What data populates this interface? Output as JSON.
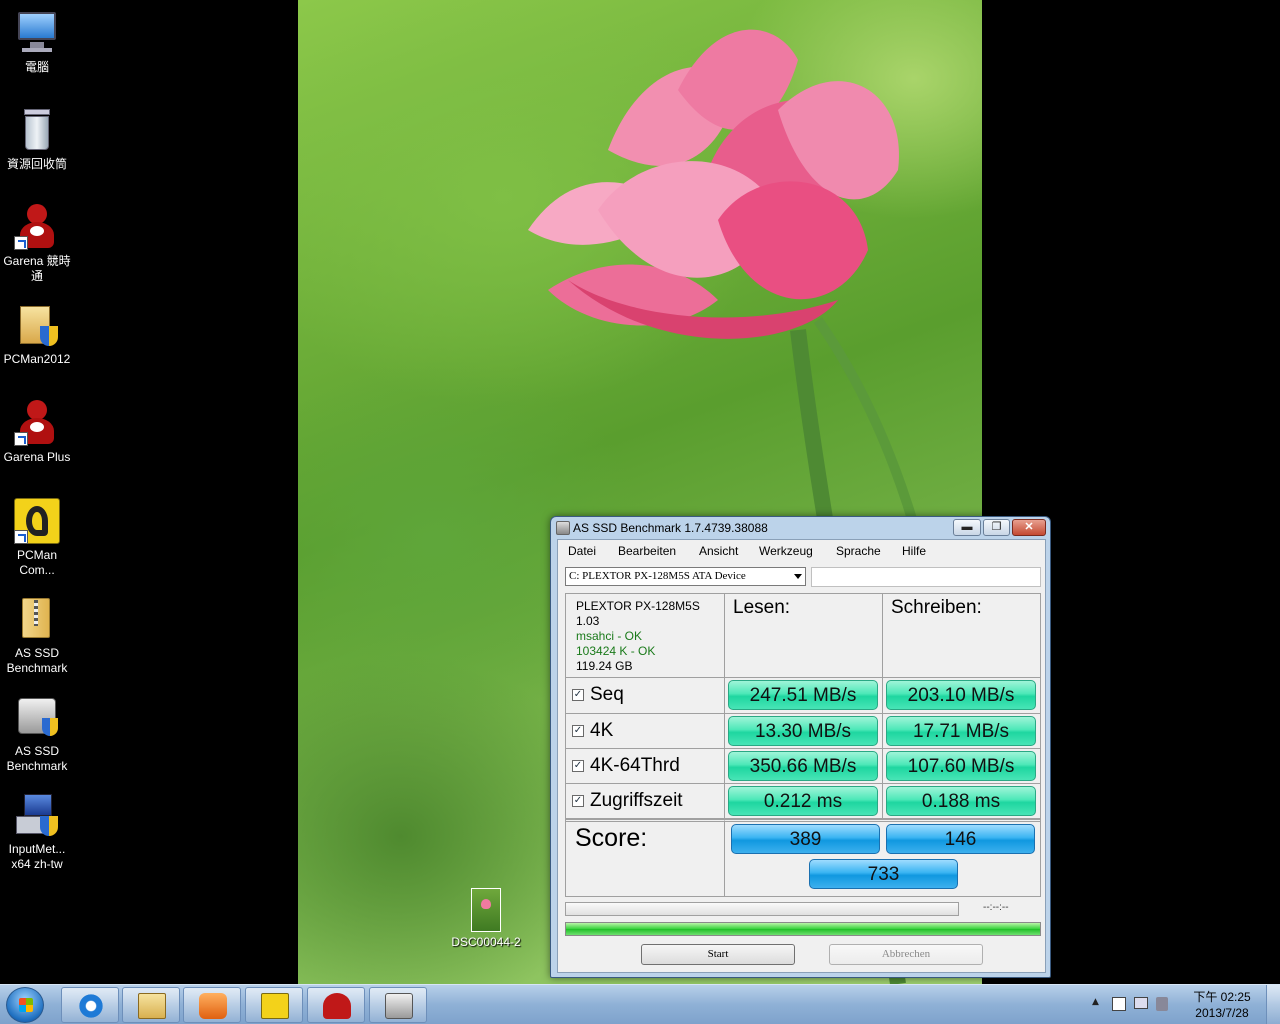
{
  "desktop": {
    "icons": [
      {
        "label": "電腦",
        "icon": "computer-icon"
      },
      {
        "label": "資源回收筒",
        "icon": "recycle-bin-icon"
      },
      {
        "label": "Garena 競時通",
        "icon": "garena-icon"
      },
      {
        "label": "PCMan2012",
        "icon": "installer-icon"
      },
      {
        "label": "Garena Plus",
        "icon": "garena-icon"
      },
      {
        "label": "PCMan Com...",
        "icon": "pcman-icon"
      },
      {
        "label": "AS SSD Benchmark",
        "icon": "zip-folder-icon"
      },
      {
        "label": "AS SSD Benchmark",
        "icon": "hdd-icon"
      },
      {
        "label": "InputMet... x64 zh-tw",
        "icon": "installer-icon"
      }
    ],
    "file": {
      "label": "DSC00044-2",
      "icon": "image-file-icon"
    }
  },
  "window": {
    "title": "AS SSD Benchmark 1.7.4739.38088",
    "menu": [
      "Datei",
      "Bearbeiten",
      "Ansicht",
      "Werkzeug",
      "Sprache",
      "Hilfe"
    ],
    "drive": "C: PLEXTOR PX-128M5S ATA Device",
    "info": {
      "model": "PLEXTOR PX-128M5S",
      "firmware": "1.03",
      "driver": "msahci - OK",
      "alignment": "103424 K - OK",
      "size": "119.24 GB"
    },
    "col_read": "Lesen:",
    "col_write": "Schreiben:",
    "rows": [
      {
        "label": "Seq",
        "checked": "✓",
        "read": "247.51 MB/s",
        "write": "203.10 MB/s"
      },
      {
        "label": "4K",
        "checked": "✓",
        "read": "13.30 MB/s",
        "write": "17.71 MB/s"
      },
      {
        "label": "4K-64Thrd",
        "checked": "✓",
        "read": "350.66 MB/s",
        "write": "107.60 MB/s"
      },
      {
        "label": "Zugriffszeit",
        "checked": "✓",
        "read": "0.212 ms",
        "write": "0.188 ms"
      }
    ],
    "score_label": "Score:",
    "score_read": "389",
    "score_write": "146",
    "score_total": "733",
    "time": "--:--:--",
    "progress_fraction": 1.0,
    "start_label": "Start",
    "abort_label": "Abbrechen",
    "min_glyph": "▬",
    "max_glyph": "❐",
    "close_glyph": "✕"
  },
  "taskbar": {
    "clock_time": "下午 02:25",
    "clock_date": "2013/7/28",
    "tray_arrow": "▲"
  }
}
